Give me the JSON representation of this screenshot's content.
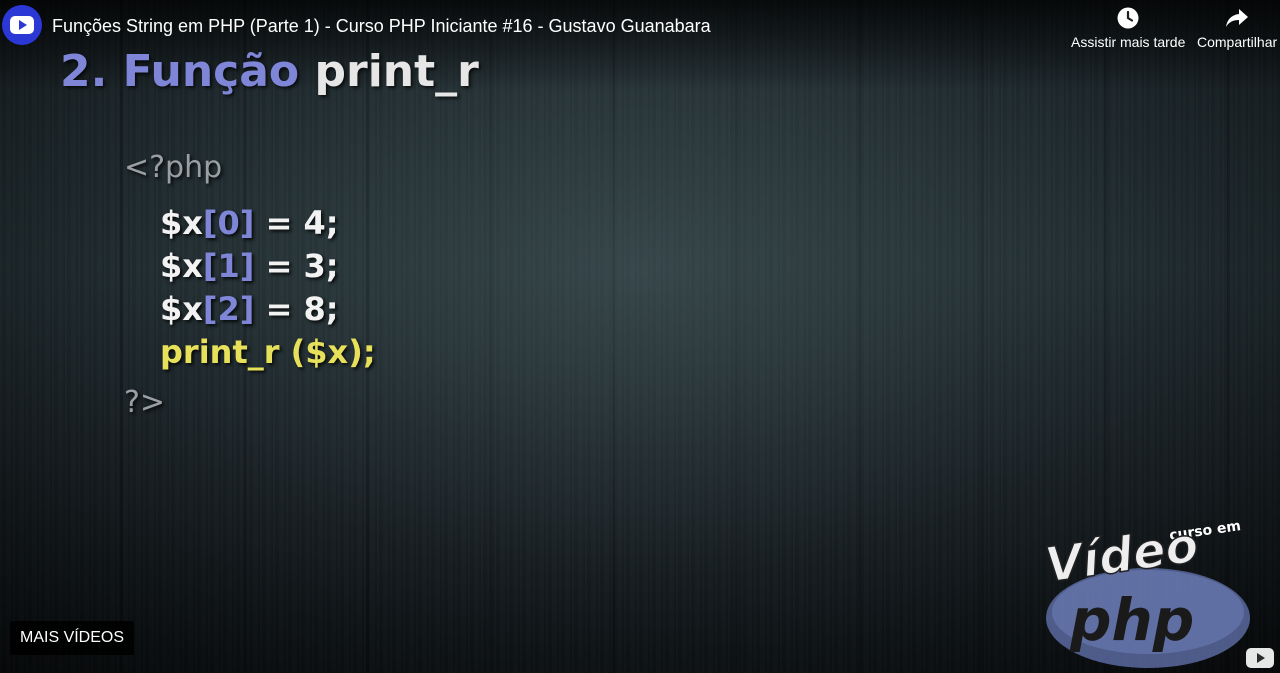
{
  "header": {
    "video_title": "Funções String em PHP (Parte 1) - Curso PHP Iniciante #16 - Gustavo Guanabara",
    "watch_later_label": "Assistir mais tarde",
    "share_label": "Compartilhar",
    "watch_later_icon": "clock-icon",
    "share_icon": "share-arrow-icon"
  },
  "slide": {
    "title_number": "2. Função",
    "title_function": "print_r",
    "php_open": "<?php",
    "lines": [
      {
        "var": "$x",
        "index": "[0]",
        "rest": " = 4;"
      },
      {
        "var": "$x",
        "index": "[1]",
        "rest": " = 3;"
      },
      {
        "var": "$x",
        "index": "[2]",
        "rest": " = 8;"
      }
    ],
    "call_line": "print_r ($x);",
    "php_close": "?>"
  },
  "overlay": {
    "more_videos_label": "MAIS VÍDEOS"
  },
  "logo": {
    "small": "curso em",
    "main": "Vídeo",
    "sub": "php"
  },
  "colors": {
    "accent_blue": "#7f86d8",
    "code_yellow": "#e6e05a",
    "channel_avatar": "#2b38d6"
  }
}
